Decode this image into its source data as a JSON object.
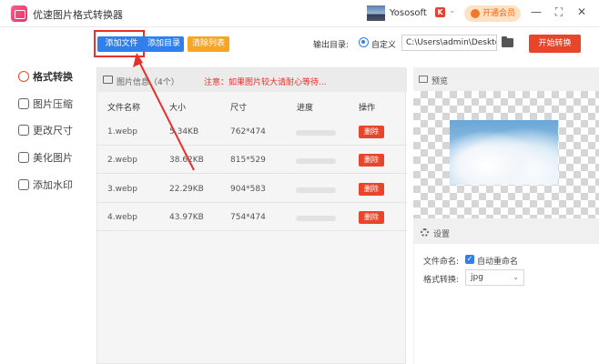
{
  "titlebar": {
    "app_title": "优速图片格式转换器",
    "user_name": "Yososoft",
    "vip_label": "开通会员",
    "min": "—",
    "max": "⛶",
    "close": "✕"
  },
  "toolbar": {
    "add_file": "添加文件",
    "add_dir": "添加目录",
    "clear_list": "清除列表",
    "output_label": "输出目录:",
    "radio_label": "自定义",
    "output_path": "C:\\Users\\admin\\Deskto",
    "start": "开始转换"
  },
  "sidebar": {
    "items": [
      {
        "label": "格式转换"
      },
      {
        "label": "图片压缩"
      },
      {
        "label": "更改尺寸"
      },
      {
        "label": "美化图片"
      },
      {
        "label": "添加水印"
      }
    ]
  },
  "filelist": {
    "title": "图片信息（4个）",
    "warning": "注意：如果图片较大请耐心等待...",
    "columns": [
      "文件名称",
      "大小",
      "尺寸",
      "进度",
      "操作"
    ],
    "rows": [
      {
        "name": "1.webp",
        "size": "5.34KB",
        "dims": "762*474",
        "action": "删除"
      },
      {
        "name": "2.webp",
        "size": "38.62KB",
        "dims": "815*529",
        "action": "删除"
      },
      {
        "name": "3.webp",
        "size": "22.29KB",
        "dims": "904*583",
        "action": "删除"
      },
      {
        "name": "4.webp",
        "size": "43.97KB",
        "dims": "754*474",
        "action": "删除"
      }
    ]
  },
  "preview": {
    "title": "预览"
  },
  "settings": {
    "title": "设置",
    "rename_label": "文件命名:",
    "rename_option": "自动重命名",
    "format_label": "格式转换:",
    "format_value": "jpg"
  },
  "colors": {
    "primary": "#2f80ed",
    "danger": "#e8452a",
    "warning": "#f6a623"
  }
}
